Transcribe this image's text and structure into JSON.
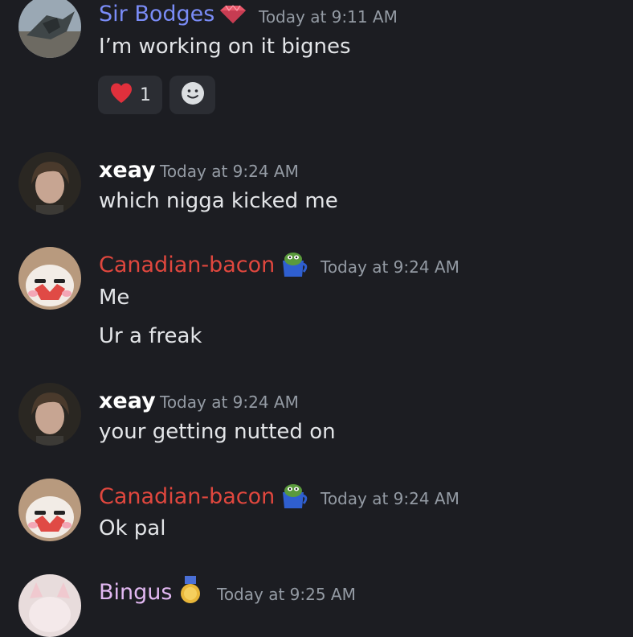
{
  "colors": {
    "background": "#1c1d22",
    "sir_bodges_name": "#7a8cf7",
    "canadian_name": "#e0473e",
    "xeay_name": "#ffffff",
    "bingus_name": "#e2b8f2",
    "timestamp": "#949ba4"
  },
  "messages": [
    {
      "author": "Sir Bodges",
      "badge": "gem-icon",
      "timestamp": "Today at 9:11 AM",
      "lines": [
        "I’m working on it bignes"
      ],
      "reactions": [
        {
          "emoji": "heart-icon",
          "count": "1"
        }
      ]
    },
    {
      "author": "xeay",
      "timestamp": "Today at 9:24 AM",
      "lines": [
        "which nigga kicked me"
      ]
    },
    {
      "author": "Canadian-bacon",
      "badge": "pepe-mug-icon",
      "timestamp": "Today at 9:24 AM",
      "lines": [
        "Me",
        "Ur a freak"
      ]
    },
    {
      "author": "xeay",
      "timestamp": "Today at 9:24 AM",
      "lines": [
        "your getting nutted on"
      ]
    },
    {
      "author": "Canadian-bacon",
      "badge": "pepe-mug-icon",
      "timestamp": "Today at 9:24 AM",
      "lines": [
        "Ok pal"
      ]
    },
    {
      "author": "Bingus",
      "badge": "medal-icon",
      "timestamp": "Today at 9:25 AM",
      "lines": []
    }
  ]
}
